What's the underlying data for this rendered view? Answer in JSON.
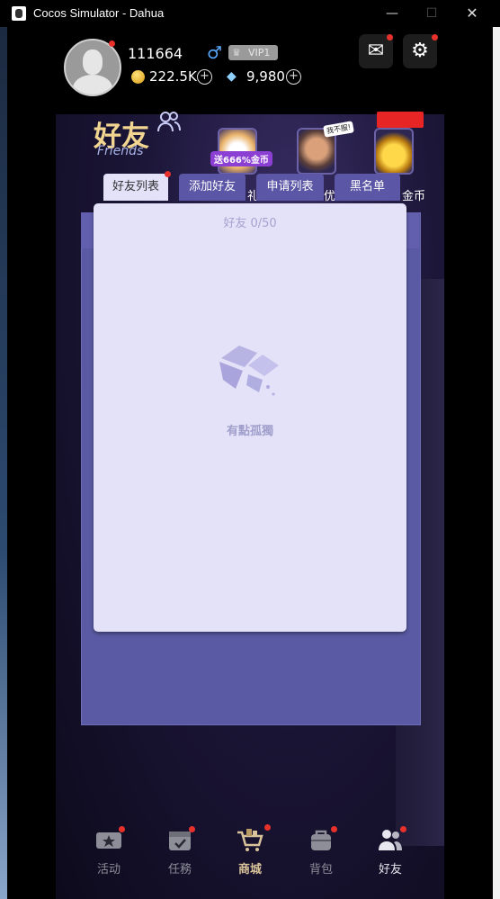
{
  "window": {
    "title": "Cocos Simulator - Dahua",
    "minimize": "—",
    "maximize": "☐",
    "close": "✕"
  },
  "player": {
    "name": "111664",
    "gender_symbol": "♂",
    "vip": "VIP1",
    "coins": "222.5K",
    "diamonds": "9,980",
    "plus": "+"
  },
  "header": {
    "title": "好友",
    "subtitle": "Friends"
  },
  "promos": [
    {
      "tag": "送666%金币",
      "edge_text": "礼"
    },
    {
      "bubble": "我不服!",
      "edge_text": "优"
    },
    {
      "edge_text": "金币"
    }
  ],
  "tabs": [
    {
      "label": "好友列表",
      "active": true
    },
    {
      "label": "添加好友"
    },
    {
      "label": "申请列表"
    },
    {
      "label": "黑名单"
    }
  ],
  "friend_list": {
    "count": "好友 0/50",
    "empty_text": "有點孤獨"
  },
  "nav": [
    {
      "label": "活动"
    },
    {
      "label": "任務"
    },
    {
      "label": "商城",
      "active": true
    },
    {
      "label": "背包"
    },
    {
      "label": "好友"
    }
  ],
  "colors": {
    "tab_active": "#e4e2f8",
    "tab_inactive": "#5b56a6",
    "panel": "#5a5aa4",
    "card": "#e3e2f8",
    "badge": "#e8312a",
    "title_gold": "#f2d591"
  }
}
